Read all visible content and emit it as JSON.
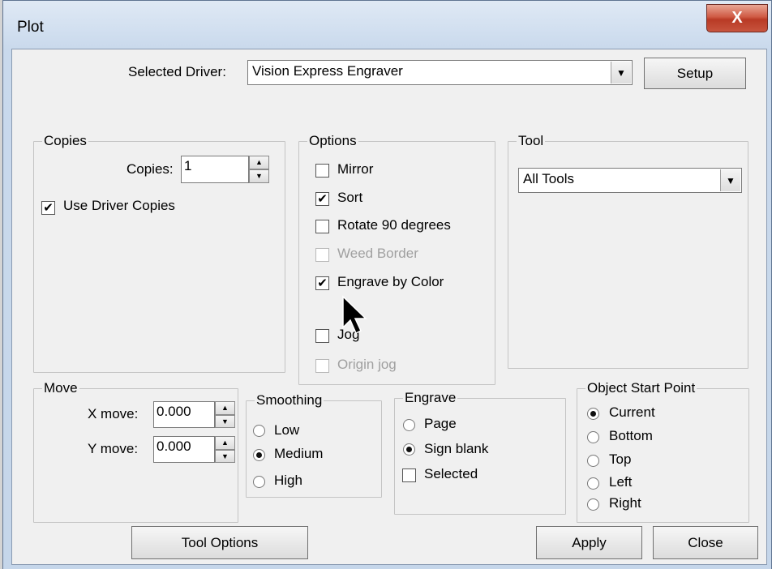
{
  "window": {
    "title": "Plot",
    "close_label": "X"
  },
  "driver": {
    "label": "Selected Driver:",
    "value": "Vision Express Engraver",
    "setup_label": "Setup"
  },
  "copies": {
    "group_label": "Copies",
    "label": "Copies:",
    "value": "1",
    "use_driver_label": "Use Driver Copies",
    "use_driver_checked": true
  },
  "options": {
    "group_label": "Options",
    "items": [
      {
        "label": "Mirror",
        "checked": false,
        "enabled": true
      },
      {
        "label": "Sort",
        "checked": true,
        "enabled": true
      },
      {
        "label": "Rotate 90 degrees",
        "checked": false,
        "enabled": true
      },
      {
        "label": "Weed Border",
        "checked": false,
        "enabled": false
      },
      {
        "label": "Engrave by Color",
        "checked": true,
        "enabled": true
      },
      {
        "label": "Jog",
        "checked": false,
        "enabled": true
      },
      {
        "label": "Origin jog",
        "checked": false,
        "enabled": false
      }
    ]
  },
  "tool": {
    "group_label": "Tool",
    "value": "All Tools"
  },
  "move": {
    "group_label": "Move",
    "x_label": "X move:",
    "x_value": "0.000",
    "y_label": "Y move:",
    "y_value": "0.000"
  },
  "smoothing": {
    "group_label": "Smoothing",
    "options": [
      "Low",
      "Medium",
      "High"
    ],
    "selected": "Medium"
  },
  "engrave": {
    "group_label": "Engrave",
    "options": [
      "Page",
      "Sign blank"
    ],
    "selected": "Sign blank",
    "selected_label": "Selected",
    "selected_checked": false
  },
  "start_point": {
    "group_label": "Object Start Point",
    "options": [
      "Current",
      "Bottom",
      "Top",
      "Left",
      "Right"
    ],
    "selected": "Current"
  },
  "buttons": {
    "tool_options": "Tool Options",
    "apply": "Apply",
    "close": "Close"
  },
  "icons": {
    "check": "✔",
    "dropdown": "▼",
    "spin_up": "▲",
    "spin_down": "▼"
  }
}
